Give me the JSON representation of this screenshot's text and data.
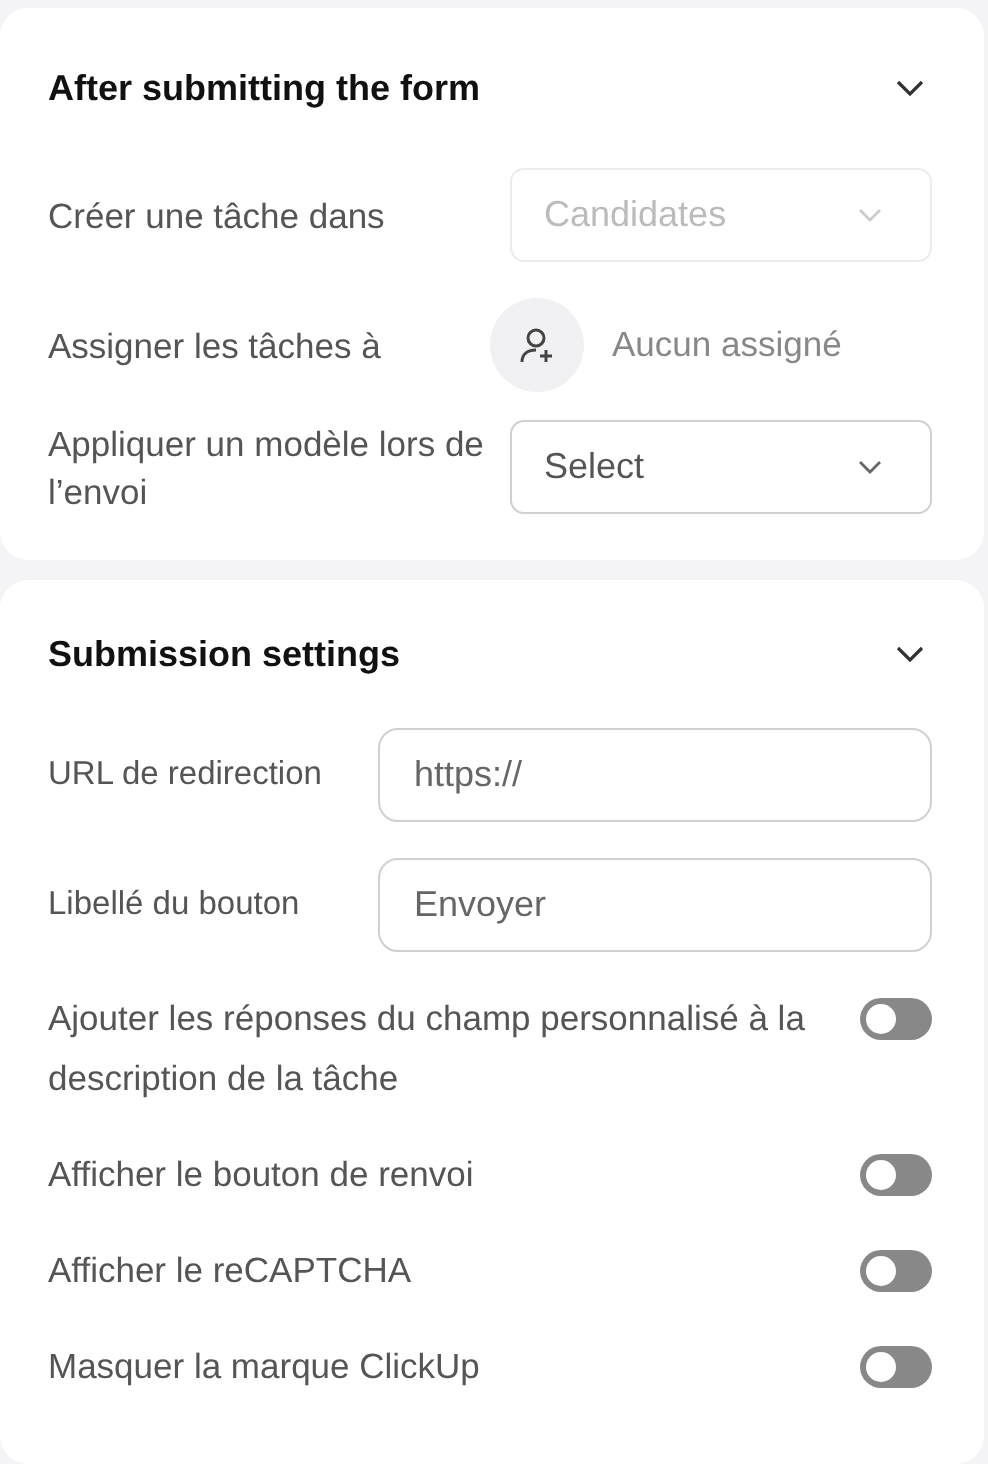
{
  "after_submit": {
    "title": "After submitting the form",
    "expanded": true,
    "create_task": {
      "label": "Créer une tâche dans",
      "value": "Candidates",
      "disabled": true
    },
    "assign": {
      "label": "Assigner les tâches à",
      "value": "Aucun assigné"
    },
    "template": {
      "label": "Appliquer un modèle lors de l’envoi",
      "value": "Select",
      "disabled": false
    }
  },
  "submission": {
    "title": "Submission settings",
    "expanded": true,
    "fields": [
      {
        "label": "URL de redirection",
        "placeholder": "https://"
      },
      {
        "label": "Libellé du bouton",
        "placeholder": "Envoyer"
      }
    ],
    "toggles": [
      {
        "label": "Ajouter les réponses du champ personnalisé à la description de la tâche",
        "on": false
      },
      {
        "label": "Afficher le bouton de renvoi",
        "on": false
      },
      {
        "label": "Afficher le reCAPTCHA",
        "on": false
      },
      {
        "label": "Masquer la marque ClickUp",
        "on": false
      }
    ]
  }
}
